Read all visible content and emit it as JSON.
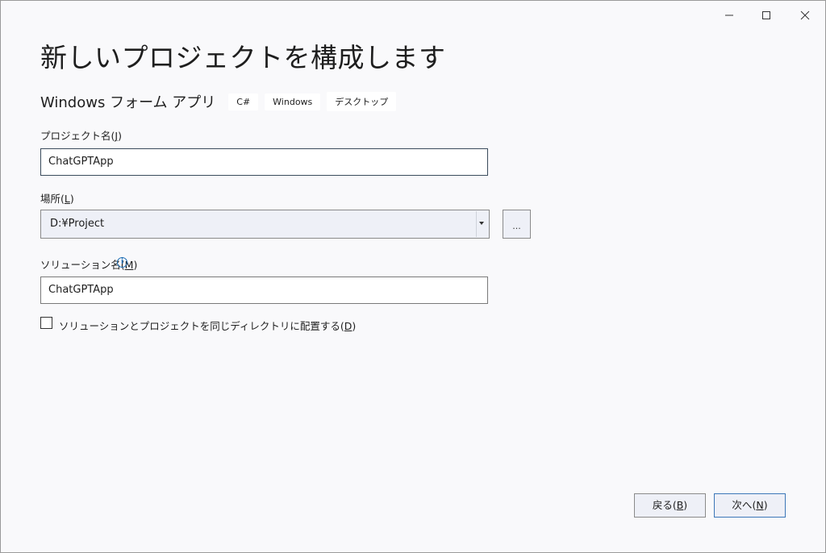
{
  "window": {
    "controls": {
      "minimize": "minimize-icon",
      "maximize": "maximize-icon",
      "close": "close-icon"
    }
  },
  "header": {
    "title": "新しいプロジェクトを構成します",
    "template_name": "Windows フォーム アプリ",
    "tags": [
      "C#",
      "Windows",
      "デスクトップ"
    ]
  },
  "form": {
    "project_name": {
      "label": "プロジェクト名",
      "accesskey": "J",
      "value": "ChatGPTApp"
    },
    "location": {
      "label": "場所",
      "accesskey": "L",
      "value": "D:¥Project",
      "browse_label": "..."
    },
    "solution_name": {
      "label": "ソリューション名",
      "accesskey": "M",
      "value": "ChatGPTApp",
      "info_icon": "i"
    },
    "same_dir": {
      "label": "ソリューションとプロジェクトを同じディレクトリに配置する",
      "accesskey": "D",
      "checked": false
    }
  },
  "footer": {
    "back": {
      "label": "戻る",
      "accesskey": "B"
    },
    "next": {
      "label": "次へ",
      "accesskey": "N"
    }
  },
  "colors": {
    "accent": "#3c77b8",
    "info": "#1f6fb5",
    "background": "#f9f9fb"
  }
}
